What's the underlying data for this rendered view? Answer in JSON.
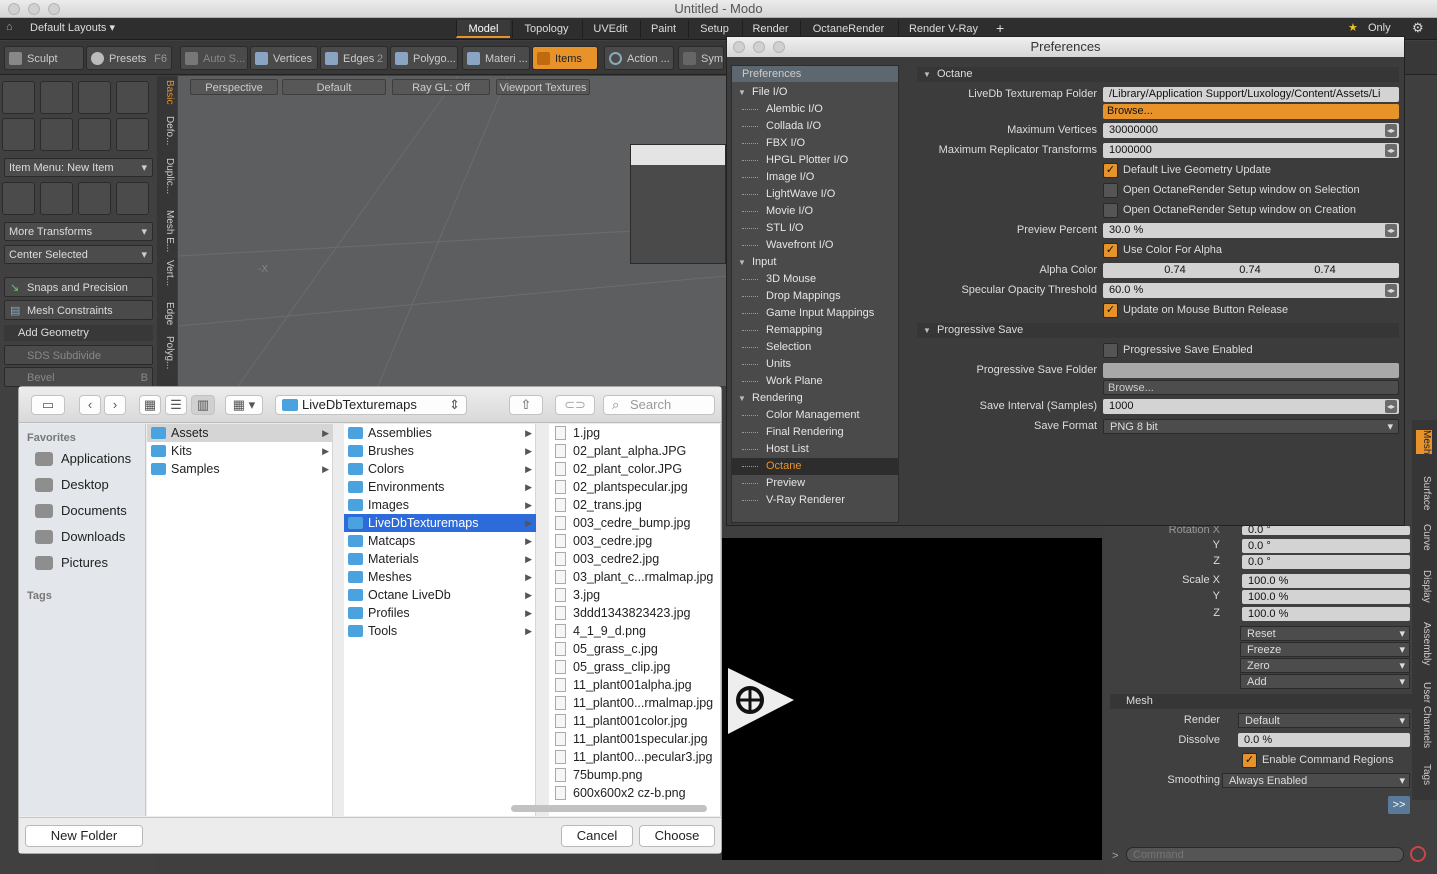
{
  "window": {
    "title": "Untitled - Modo"
  },
  "topbar": {
    "layout_label": "Default Layouts ▾",
    "tabs": [
      "Model",
      "Topology",
      "UVEdit",
      "Paint",
      "Setup",
      "Render",
      "OctaneRender",
      "Render V-Ray"
    ],
    "active_tab": "Model",
    "add_tab": "+",
    "only_label": "Only"
  },
  "toolbar": {
    "sculpt": "Sculpt",
    "presets": "Presets",
    "presets_key": "F6",
    "auto": "Auto S...",
    "vertices": "Vertices",
    "edges": "Edges",
    "edges_count": "2",
    "polygons": "Polygo...",
    "materials": "Materi ...",
    "items": "Items",
    "action": "Action ...",
    "sym": "Sym"
  },
  "left": {
    "item_menu": "Item Menu: New Item",
    "more_transforms": "More Transforms",
    "center_selected": "Center Selected",
    "snaps": "Snaps and Precision",
    "mesh_constraints": "Mesh Constraints",
    "add_geometry": "Add Geometry",
    "sds_subdivide": "SDS Subdivide",
    "bevel": "Bevel",
    "bevel_key": "B",
    "vtabs": [
      "Basic",
      "Defo...",
      "Duplic...",
      "Mesh E...",
      "Vert...",
      "Edge",
      "Polyg..."
    ]
  },
  "viewport": {
    "buttons": [
      "Perspective",
      "Default",
      "Ray GL: Off",
      "Viewport Textures"
    ],
    "axis_marker": "-X"
  },
  "prefs": {
    "title": "Preferences",
    "tree_header": "Preferences",
    "tree": [
      {
        "label": "File I/O",
        "kind": "cat"
      },
      {
        "label": "Alembic I/O",
        "kind": "sub"
      },
      {
        "label": "Collada I/O",
        "kind": "sub"
      },
      {
        "label": "FBX I/O",
        "kind": "sub"
      },
      {
        "label": "HPGL Plotter I/O",
        "kind": "sub"
      },
      {
        "label": "Image I/O",
        "kind": "sub"
      },
      {
        "label": "LightWave I/O",
        "kind": "sub"
      },
      {
        "label": "Movie I/O",
        "kind": "sub"
      },
      {
        "label": "STL I/O",
        "kind": "sub"
      },
      {
        "label": "Wavefront I/O",
        "kind": "sub"
      },
      {
        "label": "Input",
        "kind": "cat"
      },
      {
        "label": "3D Mouse",
        "kind": "sub"
      },
      {
        "label": "Drop Mappings",
        "kind": "sub"
      },
      {
        "label": "Game Input Mappings",
        "kind": "sub"
      },
      {
        "label": "Remapping",
        "kind": "sub"
      },
      {
        "label": "Selection",
        "kind": "sub"
      },
      {
        "label": "Units",
        "kind": "sub"
      },
      {
        "label": "Work Plane",
        "kind": "sub"
      },
      {
        "label": "Rendering",
        "kind": "cat"
      },
      {
        "label": "Color Management",
        "kind": "sub"
      },
      {
        "label": "Final Rendering",
        "kind": "sub"
      },
      {
        "label": "Host List",
        "kind": "sub"
      },
      {
        "label": "Octane",
        "kind": "sub",
        "selected": true
      },
      {
        "label": "Preview",
        "kind": "sub"
      },
      {
        "label": "V-Ray Renderer",
        "kind": "sub"
      }
    ],
    "octane_section": "Octane",
    "livedb_label": "LiveDb Texturemap Folder",
    "livedb_value": "/Library/Application Support/Luxology/Content/Assets/Li",
    "browse": "Browse...",
    "max_vertices_label": "Maximum Vertices",
    "max_vertices": "30000000",
    "max_repl_label": "Maximum Replicator Transforms",
    "max_repl": "1000000",
    "default_live_geo": "Default Live Geometry Update",
    "open_on_selection": "Open OctaneRender Setup window on Selection",
    "open_on_creation": "Open OctaneRender Setup window on Creation",
    "preview_percent_label": "Preview Percent",
    "preview_percent": "30.0 %",
    "use_color_alpha": "Use Color For Alpha",
    "alpha_color_label": "Alpha Color",
    "alpha_color": [
      "0.74",
      "0.74",
      "0.74"
    ],
    "spec_opacity_label": "Specular Opacity Threshold",
    "spec_opacity": "60.0 %",
    "update_on_release": "Update on Mouse Button Release",
    "prog_section": "Progressive Save",
    "prog_enabled": "Progressive Save Enabled",
    "prog_folder_label": "Progressive Save Folder",
    "prog_folder_value": "",
    "prog_browse": "Browse...",
    "save_interval_label": "Save Interval (Samples)",
    "save_interval": "1000",
    "save_format_label": "Save Format",
    "save_format": "PNG 8 bit"
  },
  "right": {
    "rotation_x_label": "Rotation X",
    "rotation_x": "0.0 °",
    "rot_y_label": "Y",
    "rot_y": "0.0 °",
    "rot_z_label": "Z",
    "rot_z": "0.0 °",
    "scale_x_label": "Scale X",
    "scale_x": "100.0 %",
    "scale_y_label": "Y",
    "scale_y": "100.0 %",
    "scale_z_label": "Z",
    "scale_z": "100.0 %",
    "reset": "Reset",
    "freeze": "Freeze",
    "zero": "Zero",
    "add": "Add",
    "mesh_section": "Mesh",
    "render_label": "Render",
    "render_value": "Default",
    "dissolve_label": "Dissolve",
    "dissolve_value": "0.0 %",
    "enable_cmd_regions": "Enable Command Regions",
    "smoothing_label": "Smoothing",
    "smoothing_value": "Always Enabled",
    "more": ">>",
    "command_placeholder": "Command",
    "vtabs": [
      "Mesh",
      "Surface",
      "Curve",
      "Display",
      "Assembly",
      "User Channels",
      "Tags"
    ]
  },
  "dialog": {
    "path_popup": "LiveDbTexturemaps",
    "search_placeholder": "Search",
    "favorites_head": "Favorites",
    "favorites": [
      "Applications",
      "Desktop",
      "Documents",
      "Downloads",
      "Pictures"
    ],
    "tags_head": "Tags",
    "col1": [
      "Assets",
      "Kits",
      "Samples"
    ],
    "col2": [
      "Assemblies",
      "Brushes",
      "Colors",
      "Environments",
      "Images",
      "LiveDbTexturemaps",
      "Matcaps",
      "Materials",
      "Meshes",
      "Octane LiveDb",
      "Profiles",
      "Tools"
    ],
    "col3": [
      "1.jpg",
      "02_plant_alpha.JPG",
      "02_plant_color.JPG",
      "02_plantspecular.jpg",
      "02_trans.jpg",
      "003_cedre_bump.jpg",
      "003_cedre.jpg",
      "003_cedre2.jpg",
      "03_plant_c...rmalmap.jpg",
      "3.jpg",
      "3ddd1343823423.jpg",
      "4_1_9_d.png",
      "05_grass_c.jpg",
      "05_grass_clip.jpg",
      "11_plant001alpha.jpg",
      "11_plant00...rmalmap.jpg",
      "11_plant001color.jpg",
      "11_plant001specular.jpg",
      "11_plant00...pecular3.jpg",
      "75bump.png",
      "600x600x2 cz-b.png"
    ],
    "new_folder": "New Folder",
    "cancel": "Cancel",
    "choose": "Choose"
  },
  "colors": {
    "accent": "#e8932a",
    "selection": "#2c6bd9"
  }
}
